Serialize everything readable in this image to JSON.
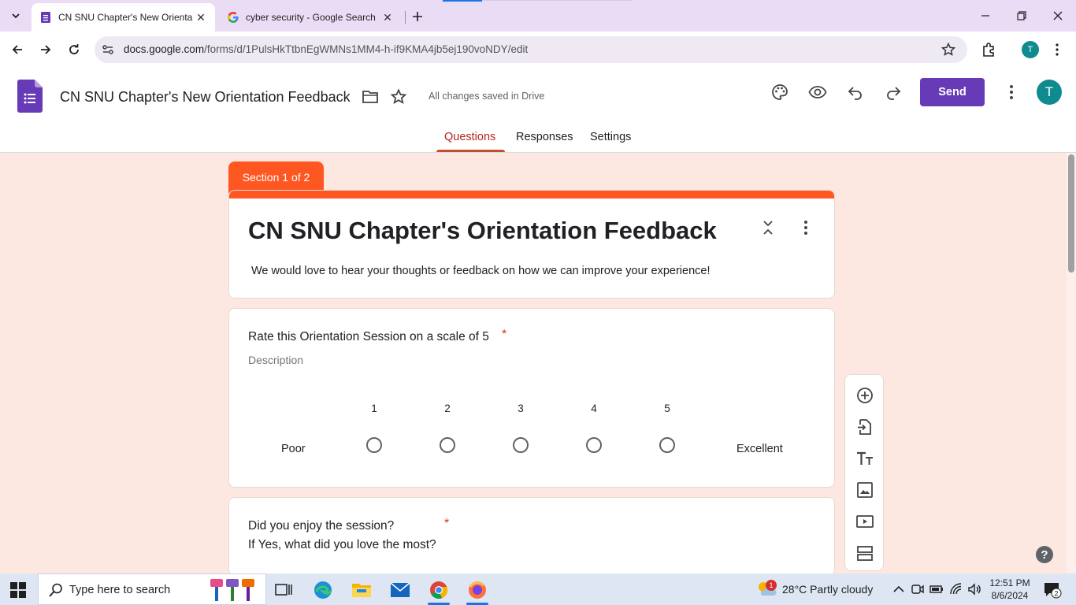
{
  "browser": {
    "tabs": [
      {
        "title": "CN SNU Chapter's New Orienta",
        "active": true
      },
      {
        "title": "cyber security - Google Search",
        "active": false
      }
    ],
    "url_host": "docs.google.com",
    "url_path": "/forms/d/1PulsHkTtbnEgWMNs1MM4-h-if9KMA4jb5ej190voNDY/edit",
    "profile_initial": "T"
  },
  "header": {
    "doc_title": "CN SNU Chapter's New Orientation Feedback",
    "saved_status": "All changes saved in Drive",
    "send_label": "Send",
    "avatar_initial": "T",
    "tabs": [
      "Questions",
      "Responses",
      "Settings"
    ],
    "active_tab": "Questions"
  },
  "form": {
    "section_label": "Section 1 of 2",
    "title": "CN SNU Chapter's Orientation Feedback",
    "description": "We would love to hear your thoughts or feedback on how we can improve your experience!",
    "accent_color": "#ff5722",
    "questions": [
      {
        "title": "Rate this Orientation Session on a scale of 5",
        "required_mark": "*",
        "description_placeholder": "Description",
        "scale": [
          "1",
          "2",
          "3",
          "4",
          "5"
        ],
        "low_label": "Poor",
        "high_label": "Excellent"
      },
      {
        "title_line1": "Did you enjoy the session?",
        "title_line2": "If Yes, what did you love the most?",
        "required_mark": "*"
      }
    ]
  },
  "side_toolbar": [
    "add-question",
    "import-questions",
    "add-title",
    "add-image",
    "add-video",
    "add-section"
  ],
  "taskbar": {
    "search_placeholder": "Type here to search",
    "weather_badge": "1",
    "weather_text": "28°C  Partly cloudy",
    "time": "12:51 PM",
    "date": "8/6/2024",
    "notification_count": "2"
  }
}
